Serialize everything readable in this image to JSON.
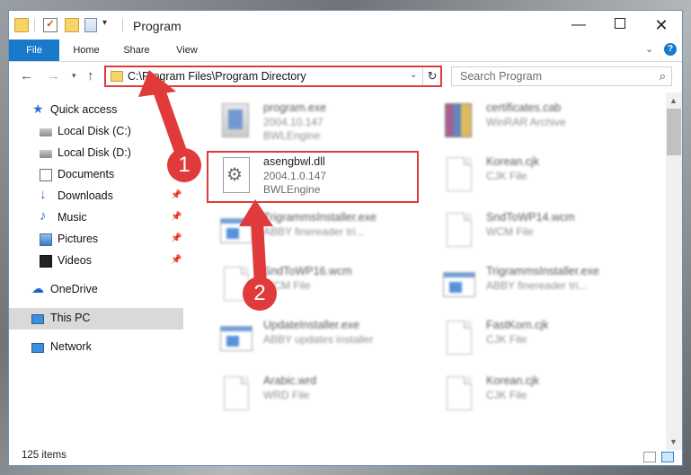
{
  "window": {
    "title": "Program",
    "controls": {
      "minimize": "—",
      "close": "✕"
    }
  },
  "ribbon": {
    "tabs": [
      "File",
      "Home",
      "Share",
      "View"
    ],
    "help": "?"
  },
  "nav": {
    "address": "C:\\Program Files\\Program Directory",
    "search_placeholder": "Search Program"
  },
  "sidebar": {
    "items": [
      {
        "label": "Quick access",
        "icon": "star-icon",
        "pinned": false
      },
      {
        "label": "Local Disk (C:)",
        "icon": "disk-icon",
        "pinned": false
      },
      {
        "label": "Local Disk (D:)",
        "icon": "disk-icon",
        "pinned": false
      },
      {
        "label": "Documents",
        "icon": "documents-icon",
        "pinned": true
      },
      {
        "label": "Downloads",
        "icon": "downloads-icon",
        "pinned": true
      },
      {
        "label": "Music",
        "icon": "music-icon",
        "pinned": true
      },
      {
        "label": "Pictures",
        "icon": "pictures-icon",
        "pinned": true
      },
      {
        "label": "Videos",
        "icon": "videos-icon",
        "pinned": true
      },
      {
        "label": "OneDrive",
        "icon": "onedrive-icon",
        "pinned": false
      },
      {
        "label": "This PC",
        "icon": "this-pc-icon",
        "pinned": false,
        "selected": true
      },
      {
        "label": "Network",
        "icon": "network-icon",
        "pinned": false
      }
    ]
  },
  "files": [
    {
      "name": "program.exe",
      "line2": "2004.10.147",
      "line3": "BWLEngine",
      "icon": "program-exe-icon",
      "blurred": true
    },
    {
      "name": "certificates.cab",
      "line2": "WinRAR Archive",
      "line3": "",
      "icon": "winrar-archive-icon",
      "blurred": true
    },
    {
      "name": "asengbwl.dll",
      "line2": "2004.1.0.147",
      "line3": "BWLEngine",
      "icon": "dll-file-icon",
      "blurred": false,
      "highlighted": true
    },
    {
      "name": "Korean.cjk",
      "line2": "CJK File",
      "line3": "",
      "icon": "blank-file-icon",
      "blurred": true
    },
    {
      "name": "TrigrammsInstaller.exe",
      "line2": "ABBY finereader tri...",
      "line3": "",
      "icon": "installer-exe-icon",
      "blurred": true
    },
    {
      "name": "SndToWP14.wcm",
      "line2": "WCM File",
      "line3": "",
      "icon": "blank-file-icon",
      "blurred": true
    },
    {
      "name": "SndToWP16.wcm",
      "line2": "WCM File",
      "line3": "",
      "icon": "blank-file-icon",
      "blurred": true
    },
    {
      "name": "TrigrammsInstaller.exe",
      "line2": "ABBY finereader tri...",
      "line3": "",
      "icon": "installer-exe-icon",
      "blurred": true
    },
    {
      "name": "UpdateInstaller.exe",
      "line2": "ABBY updates installer",
      "line3": "",
      "icon": "installer-exe-icon",
      "blurred": true
    },
    {
      "name": "FastKorn.cjk",
      "line2": "CJK File",
      "line3": "",
      "icon": "blank-file-icon",
      "blurred": true
    },
    {
      "name": "Arabic.wrd",
      "line2": "WRD File",
      "line3": "",
      "icon": "blank-file-icon",
      "blurred": true
    },
    {
      "name": "Korean.cjk",
      "line2": "CJK File",
      "line3": "",
      "icon": "blank-file-icon",
      "blurred": true
    }
  ],
  "status": {
    "item_count": "125 items"
  },
  "annotations": {
    "step1": "1",
    "step2": "2",
    "color": "#e03a3a"
  }
}
